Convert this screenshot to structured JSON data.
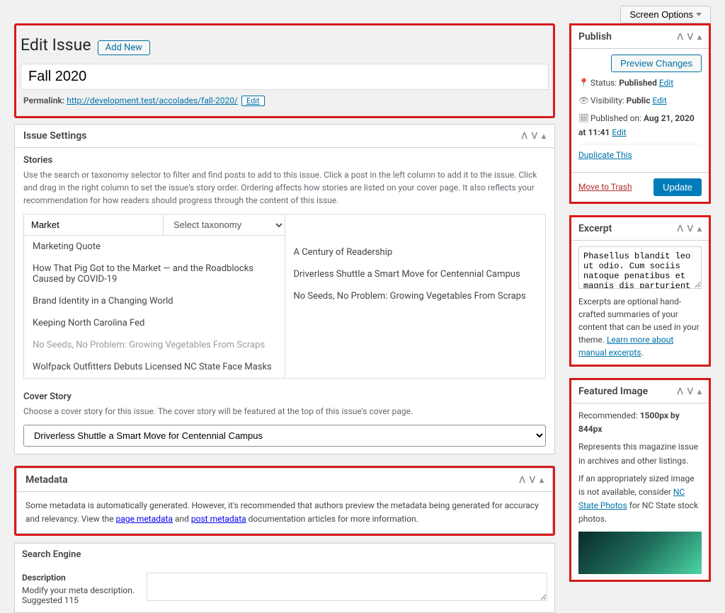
{
  "screenOptions": {
    "label": "Screen Options"
  },
  "header": {
    "pageTitle": "Edit Issue",
    "addNew": "Add New",
    "postTitle": "Fall 2020",
    "permalinkLabel": "Permalink:",
    "permalinkUrl": "http://development.test/accolades/fall-2020/",
    "permalinkEditLabel": "Edit"
  },
  "issueSettings": {
    "title": "Issue Settings",
    "stories": {
      "heading": "Stories",
      "help": "Use the search or taxonomy selector to filter and find posts to add to this issue. Click a post in the left column to add it to the issue. Click and drag in the right column to set the issue's story order. Ordering affects how stories are listed on your cover page. It also reflects your recommendation for how readers should progress through the content of this issue.",
      "searchPlaceholder": "Market",
      "taxonomyPlaceholder": "Select taxonomy",
      "available": [
        {
          "label": "Marketing Quote",
          "disabled": false
        },
        {
          "label": "How That Pig Got to the Market — and the Roadblocks Caused by COVID-19",
          "disabled": false
        },
        {
          "label": "Brand Identity in a Changing World",
          "disabled": false
        },
        {
          "label": "Keeping North Carolina Fed",
          "disabled": false
        },
        {
          "label": "No Seeds, No Problem: Growing Vegetables From Scraps",
          "disabled": true
        },
        {
          "label": "Wolfpack Outfitters Debuts Licensed NC State Face Masks",
          "disabled": false
        }
      ],
      "selected": [
        {
          "label": "A Century of Readership"
        },
        {
          "label": "Driverless Shuttle a Smart Move for Centennial Campus"
        },
        {
          "label": "No Seeds, No Problem: Growing Vegetables From Scraps"
        }
      ]
    },
    "coverStory": {
      "heading": "Cover Story",
      "help": "Choose a cover story for this issue. The cover story will be featured at the top of this issue's cover page.",
      "selected": "Driverless Shuttle a Smart Move for Centennial Campus"
    }
  },
  "metadata": {
    "title": "Metadata",
    "textA": "Some metadata is automatically generated. However, it's recommended that authors preview the metadata being generated for accuracy and relevancy. View the ",
    "linkA": "page metadata",
    "textB": " and ",
    "linkB": "post metadata",
    "textC": " documentation articles for more information."
  },
  "searchEngine": {
    "heading": "Search Engine",
    "descLabel": "Description",
    "descHelp": "Modify your meta description. Suggested 115"
  },
  "publish": {
    "title": "Publish",
    "previewBtn": "Preview Changes",
    "statusLabel": "Status:",
    "statusValue": "Published",
    "statusEdit": "Edit",
    "visibilityLabel": "Visibility:",
    "visibilityValue": "Public",
    "visibilityEdit": "Edit",
    "publishedLabel": "Published on:",
    "publishedValue": "Aug 21, 2020 at 11:41",
    "publishedEdit": "Edit",
    "duplicateLink": "Duplicate This",
    "trashLink": "Move to Trash",
    "updateBtn": "Update"
  },
  "excerpt": {
    "title": "Excerpt",
    "value": "Phasellus blandit leo ut odio. Cum sociis natoque penatibus et magnis dis parturient montes, nascetur",
    "helpA": "Excerpts are optional hand-crafted summaries of your content that can be used in your theme. ",
    "helpLink": "Learn more about manual excerpts",
    "helpB": "."
  },
  "featuredImage": {
    "title": "Featured Image",
    "recLabel": "Recommended:",
    "recValue": "1500px by 844px",
    "desc": "Represents this magazine issue in archives and other listings.",
    "altA": "If an appropriately sized image is not available, consider ",
    "altLink": "NC State Photos",
    "altB": " for NC State stock photos."
  }
}
